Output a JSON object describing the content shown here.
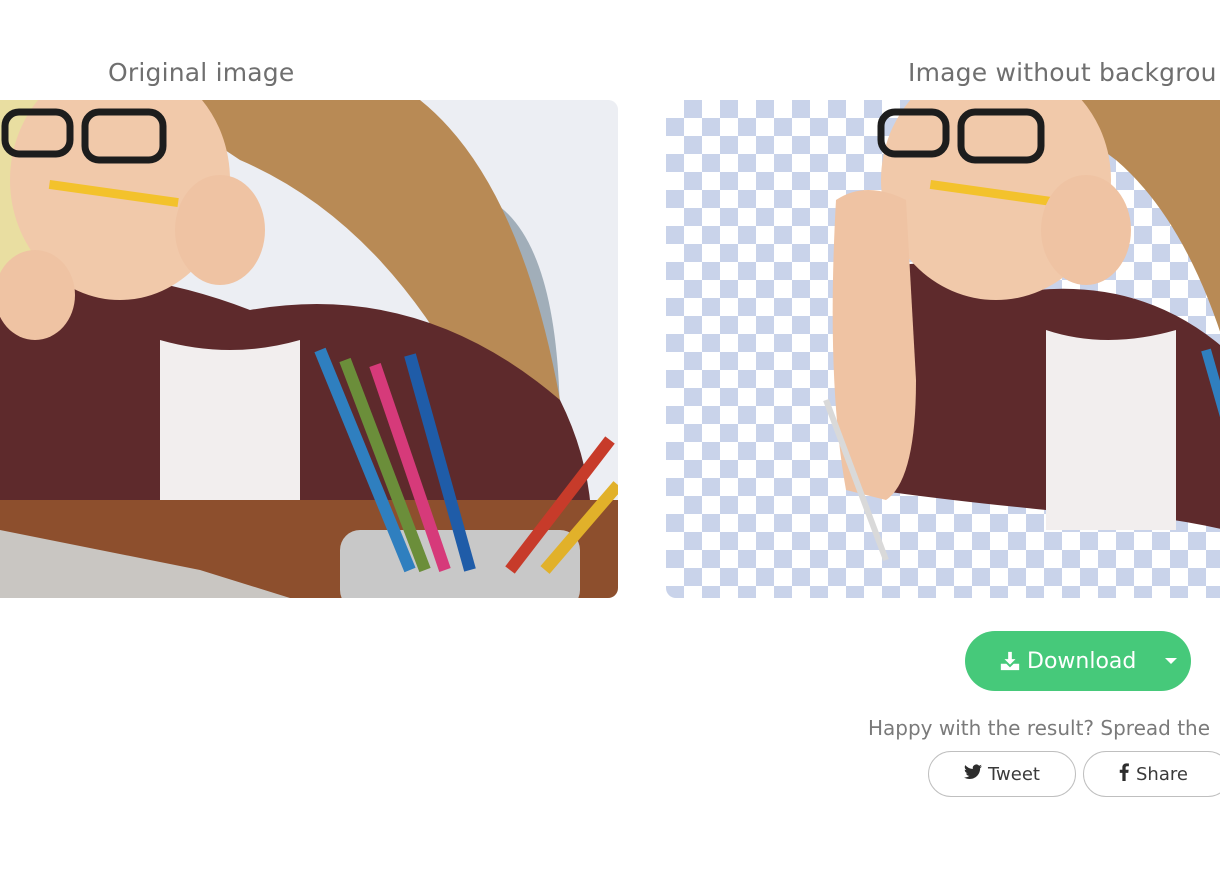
{
  "original": {
    "title": "Original image"
  },
  "result": {
    "title": "Image without backgrou"
  },
  "actions": {
    "download_label": "Download",
    "spread_text": "Happy with the result? Spread the",
    "tweet_label": "Tweet",
    "share_label": "Share"
  },
  "colors": {
    "accent": "#46c97a",
    "checker": "#c9d3ea",
    "text": "#6f6f6f"
  },
  "icons": {
    "download": "download-icon",
    "twitter": "twitter-icon",
    "facebook": "facebook-icon",
    "dropdown": "chevron-down-icon"
  }
}
